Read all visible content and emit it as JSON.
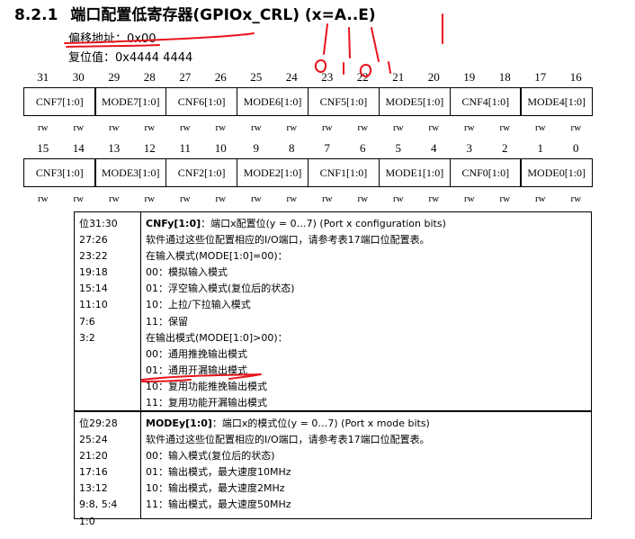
{
  "section": {
    "number": "8.2.1",
    "title": "端口配置低寄存器(GPIOx_CRL) (x=A..E)"
  },
  "offset": "偏移地址：0x00",
  "reset_value": "复位值：0x4444 4444",
  "bits_high": [
    "31",
    "30",
    "29",
    "28",
    "27",
    "26",
    "25",
    "24",
    "23",
    "22",
    "21",
    "20",
    "19",
    "18",
    "17",
    "16"
  ],
  "bits_low": [
    "15",
    "14",
    "13",
    "12",
    "11",
    "10",
    "9",
    "8",
    "7",
    "6",
    "5",
    "4",
    "3",
    "2",
    "1",
    "0"
  ],
  "fields_high": [
    "CNF7[1:0]",
    "MODE7[1:0]",
    "CNF6[1:0]",
    "MODE6[1:0]",
    "CNF5[1:0]",
    "MODE5[1:0]",
    "CNF4[1:0]",
    "MODE4[1:0]"
  ],
  "fields_low": [
    "CNF3[1:0]",
    "MODE3[1:0]",
    "CNF2[1:0]",
    "MODE2[1:0]",
    "CNF1[1:0]",
    "MODE1[1:0]",
    "CNF0[1:0]",
    "MODE0[1:0]"
  ],
  "access": "rw",
  "cnf": {
    "bits": [
      "位31:30",
      "27:26",
      "23:22",
      "19:18",
      "15:14",
      "11:10",
      "7:6",
      "3:2"
    ],
    "name": "CNFy[1:0]",
    "lines": [
      "：端口x配置位(y = 0…7) (Port x configuration bits)",
      "软件通过这些位配置相应的I/O端口，请参考表17端口位配置表。",
      "在输入模式(MODE[1:0]=00)：",
      "00：模拟输入模式",
      "01：浮空输入模式(复位后的状态)",
      "10：上拉/下拉输入模式",
      "11：保留",
      "在输出模式(MODE[1:0]>00)：",
      "00：通用推挽输出模式",
      "01：通用开漏输出模式",
      "10：复用功能推挽输出模式",
      "11：复用功能开漏输出模式"
    ]
  },
  "mode": {
    "bits": [
      "位29:28",
      "25:24",
      "21:20",
      "17:16",
      "13:12",
      "9:8, 5:4",
      "1:0"
    ],
    "name": "MODEy[1:0]",
    "lines": [
      "：端口x的模式位(y = 0…7) (Port x mode bits)",
      "软件通过这些位配置相应的I/O端口，请参考表17端口位配置表。",
      "00：输入模式(复位后的状态)",
      "01：输出模式，最大速度10MHz",
      "10：输出模式，最大速度2MHz",
      "11：输出模式，最大速度50MHz"
    ]
  },
  "annotation_color": "#e8141c"
}
